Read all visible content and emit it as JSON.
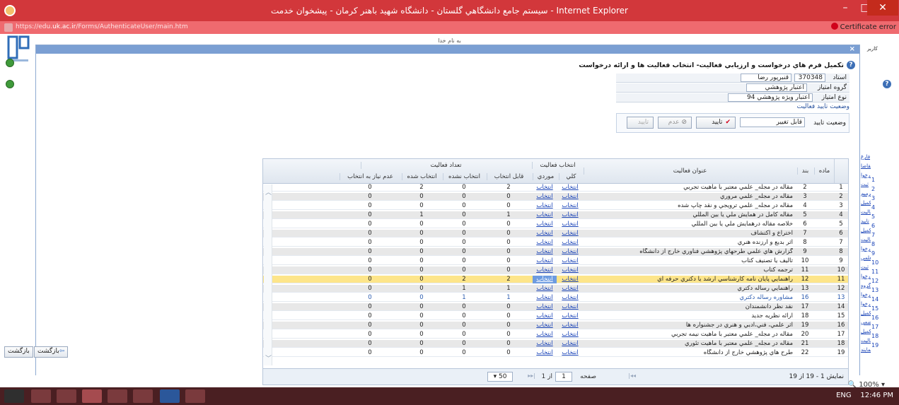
{
  "window": {
    "title": "سيستم جامع دانشگاهي گلستان - دانشگاه شهيد باهنر کرمان - پيشخوان خدمت - Internet Explorer",
    "url_prefix": "https://edu.",
    "url_host": "uk.ac.ir",
    "url_path": "/Forms/AuthenticateUser/main.htm",
    "certificate_error": "Certificate error",
    "controls": {
      "minimize": "–",
      "maximize": "□",
      "close": "✕"
    }
  },
  "page": {
    "bismillah": "به نام خدا",
    "modal_close": "×",
    "form_title": "تکميل فرم هاي درخواست و ارزيابي فعاليت- انتخاب فعاليت ها و ارائه درخواست",
    "help_icon": "?",
    "fields": {
      "professor_label": "استاد",
      "professor_code": "370348",
      "professor_name": "قنبرپور رضا",
      "group_label": "گروه امتياز",
      "group_value": "اعتبار پژوهشي",
      "type_label": "نوع امتياز",
      "type_value": "اعتبار ويژه پژوهشي 94"
    },
    "status_section_label": "وضعيت تاييد فعاليت",
    "status_label": "وضعيت تاييد",
    "status_value": "قابل تغيير",
    "buttons": {
      "approve": "تاييد",
      "approve_icon": "✔",
      "reject_icon": "⊘",
      "reject": "عدم",
      "confirm_disabled": "تاييد"
    },
    "left_back_buttons": [
      "بازگشت",
      "بازگشت"
    ],
    "right_strip_label": "کاربر",
    "right_links": [
      "فارغ",
      "تقاضا",
      "درخوا",
      "ثبت",
      "ترميم",
      "تكميل",
      "فعاليت",
      "تاييد",
      "تكميل",
      "فعاليت",
      "درخوا",
      "علمي",
      "ثبت",
      "درخوا",
      "گروه",
      "درخوا",
      "درخوا",
      "تكميل",
      "وضعي",
      "تكميل",
      "فعاليت",
      "نمايند"
    ]
  },
  "grid": {
    "headers": {
      "madeh": "ماده",
      "band": "بند",
      "title": "عنوان فعاليت",
      "selection_group": "انتخاب فعاليت",
      "mooredi": "موردي",
      "kolli": "کلي",
      "count_group": "تعداد فعاليت",
      "qabel": "قابل انتخاب",
      "entekhab_nashode": "انتخاب نشده",
      "entekhab_shode": "انتخاب شده",
      "adam_niaz": "عدم نياز به انتخاب"
    },
    "link_label": "انتخاب",
    "rows": [
      {
        "n": "1",
        "band": "2",
        "title": "مقاله در مجله_ علمي معتبر با ماهيت تجربي",
        "q": "2",
        "ns": "0",
        "s": "2",
        "a": "0"
      },
      {
        "n": "2",
        "band": "3",
        "title": "مقاله در مجله_ علمي مروري",
        "q": "0",
        "ns": "0",
        "s": "0",
        "a": "0"
      },
      {
        "n": "3",
        "band": "4",
        "title": "مقاله در مجله_ علمي ترويجي و نقد چاپ شده",
        "q": "0",
        "ns": "0",
        "s": "0",
        "a": "0"
      },
      {
        "n": "4",
        "band": "5",
        "title": "مقاله کامل در همايش ملي يا بين المللي",
        "q": "1",
        "ns": "0",
        "s": "1",
        "a": "0"
      },
      {
        "n": "5",
        "band": "6",
        "title": "خلاصه مقاله درهمايش ملي يا بين المللي",
        "q": "0",
        "ns": "0",
        "s": "0",
        "a": "0"
      },
      {
        "n": "6",
        "band": "7",
        "title": "اختراع و اکتشاف",
        "q": "0",
        "ns": "0",
        "s": "0",
        "a": "0"
      },
      {
        "n": "7",
        "band": "8",
        "title": "اثر بديع و ارزنده هنري",
        "q": "0",
        "ns": "0",
        "s": "0",
        "a": "0"
      },
      {
        "n": "8",
        "band": "9",
        "title": "گزارش هاي علمي طرحهاي پژوهشي فناوري خارج از دانشگاه",
        "q": "0",
        "ns": "0",
        "s": "0",
        "a": "0"
      },
      {
        "n": "9",
        "band": "10",
        "title": "تاليف يا تصنيف کتاب",
        "q": "0",
        "ns": "0",
        "s": "0",
        "a": "0"
      },
      {
        "n": "10",
        "band": "11",
        "title": "ترجمه کتاب",
        "q": "0",
        "ns": "0",
        "s": "0",
        "a": "0"
      },
      {
        "n": "11",
        "band": "12",
        "title": "راهنمايي پايان نامه کارشناسي ارشد يا دکتري حرفه اي",
        "q": "2",
        "ns": "2",
        "s": "0",
        "a": "0",
        "highlight": true
      },
      {
        "n": "12",
        "band": "13",
        "title": "راهنمايي رساله دکتري",
        "q": "1",
        "ns": "1",
        "s": "0",
        "a": "0"
      },
      {
        "n": "13",
        "band": "16",
        "title": "مشاوره رساله دکتري",
        "q": "1",
        "ns": "1",
        "s": "0",
        "a": "0",
        "blue": true
      },
      {
        "n": "14",
        "band": "17",
        "title": "نقد نظر دانشمندان",
        "q": "0",
        "ns": "0",
        "s": "0",
        "a": "0"
      },
      {
        "n": "15",
        "band": "18",
        "title": "ارائه نظريه جديد",
        "q": "0",
        "ns": "0",
        "s": "0",
        "a": "0"
      },
      {
        "n": "16",
        "band": "19",
        "title": "اثر علمي، فني،ادبي و هنري در جشنواره ها",
        "q": "0",
        "ns": "0",
        "s": "0",
        "a": "0"
      },
      {
        "n": "17",
        "band": "20",
        "title": "مقاله در مجله_ علمي معتبر با ماهيت نيمه تجربي",
        "q": "0",
        "ns": "0",
        "s": "0",
        "a": "0"
      },
      {
        "n": "18",
        "band": "21",
        "title": "مقاله در مجله_ علمي معتبر با ماهيت تئوري",
        "q": "0",
        "ns": "0",
        "s": "0",
        "a": "0"
      },
      {
        "n": "19",
        "band": "22",
        "title": "طرح هاي پژوهشي خارج از دانشگاه",
        "q": "0",
        "ns": "0",
        "s": "0",
        "a": "0"
      }
    ],
    "pager": {
      "info": "نمايش 1 - 19 از 19",
      "page_label": "صفحه",
      "page_value": "1",
      "of_label": "از 1",
      "page_size": "50"
    }
  },
  "status_bar": {
    "zoom": "100%"
  },
  "taskbar": {
    "lang": "ENG",
    "time": "12:46 PM"
  }
}
